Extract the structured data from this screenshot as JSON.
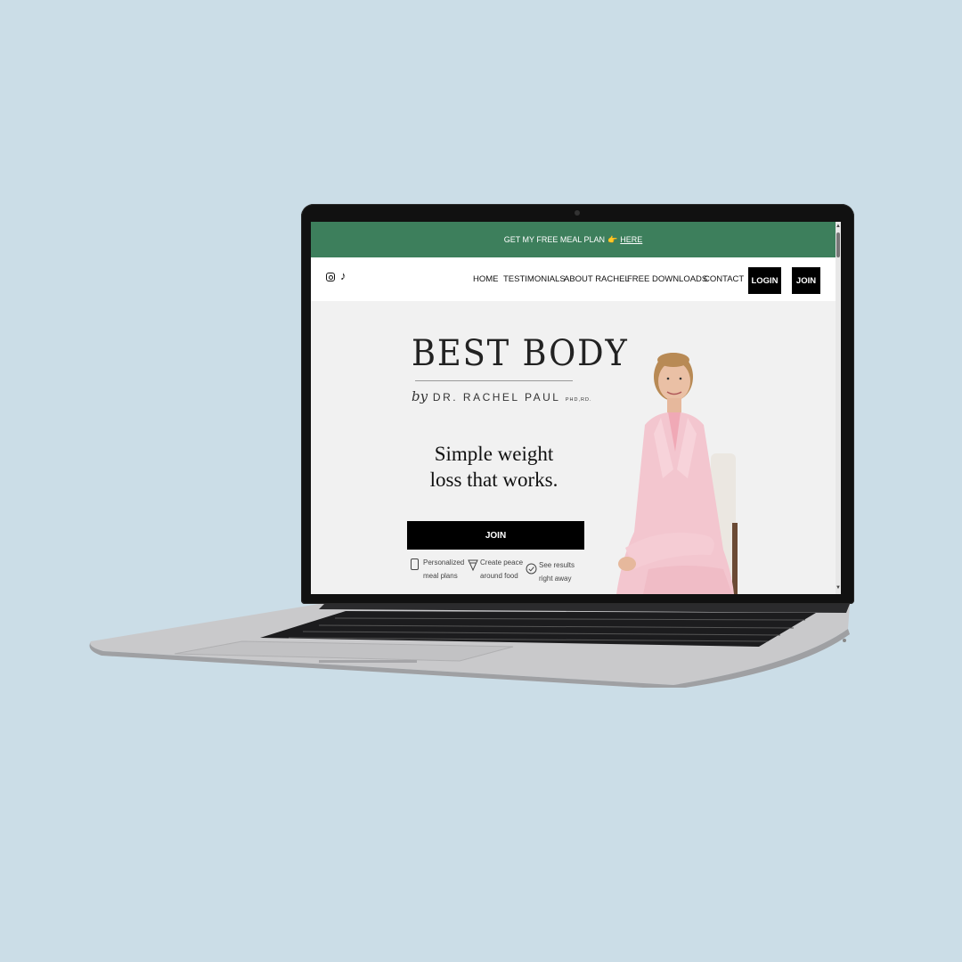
{
  "banner": {
    "text": "GET MY FREE MEAL PLAN",
    "hand": "👉",
    "link": "HERE"
  },
  "nav": {
    "links": [
      "HOME",
      "TESTIMONIALS",
      "ABOUT RACHEL",
      "FREE DOWNLOADS",
      "CONTACT"
    ],
    "login": "LOGIN",
    "join": "JOIN"
  },
  "hero": {
    "logo": "BEST BODY",
    "by": "by",
    "name": "DR. RACHEL PAUL",
    "credentials": "PHD,RD.",
    "tagline_line1": "Simple weight",
    "tagline_line2": "loss that works.",
    "cta": "JOIN"
  },
  "features": [
    {
      "line1": "Personalized",
      "line2": "meal plans",
      "icon": "document-icon"
    },
    {
      "line1": "Create peace",
      "line2": "around food",
      "icon": "food-icon"
    },
    {
      "line1": "See results",
      "line2": "right away",
      "icon": "check-circle-icon"
    }
  ],
  "colors": {
    "background": "#cbdde7",
    "banner": "#3d7f5c",
    "button": "#000000",
    "blazer": "#f3c6cf"
  }
}
